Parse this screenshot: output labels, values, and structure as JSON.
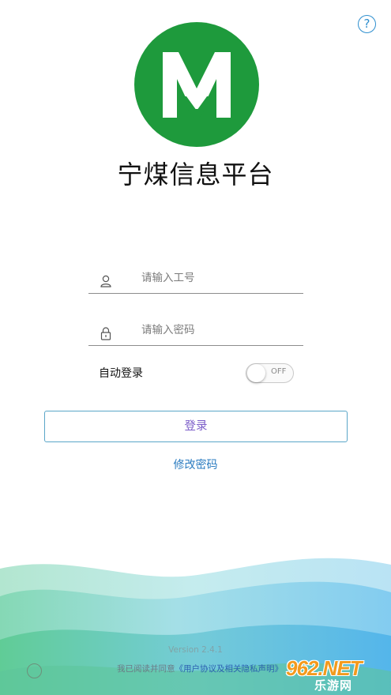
{
  "header": {
    "help_symbol": "?"
  },
  "app": {
    "title": "宁煤信息平台",
    "logo": {
      "letter": "M",
      "color": "#1e9a3c"
    }
  },
  "form": {
    "employee_id": {
      "placeholder": "请输入工号",
      "value": "",
      "icon": "user-icon"
    },
    "password": {
      "placeholder": "请输入密码",
      "value": "",
      "icon": "lock-icon"
    },
    "auto_login": {
      "label": "自动登录",
      "state": "OFF"
    },
    "login_label": "登录",
    "change_password_label": "修改密码"
  },
  "footer": {
    "version": "Version 2.4.1",
    "agreement_prefix": "我已阅读并同意",
    "agreement_link": "《用户协议及相关隐私声明》"
  },
  "watermark": {
    "top": "962.NET",
    "bottom": "乐游网"
  },
  "colors": {
    "accent_blue": "#2e8fcf",
    "link_blue": "#2a7bc0",
    "button_text": "#7a5bc8",
    "logo_green": "#1e9a3c",
    "watermark_orange": "#f39a1d"
  }
}
